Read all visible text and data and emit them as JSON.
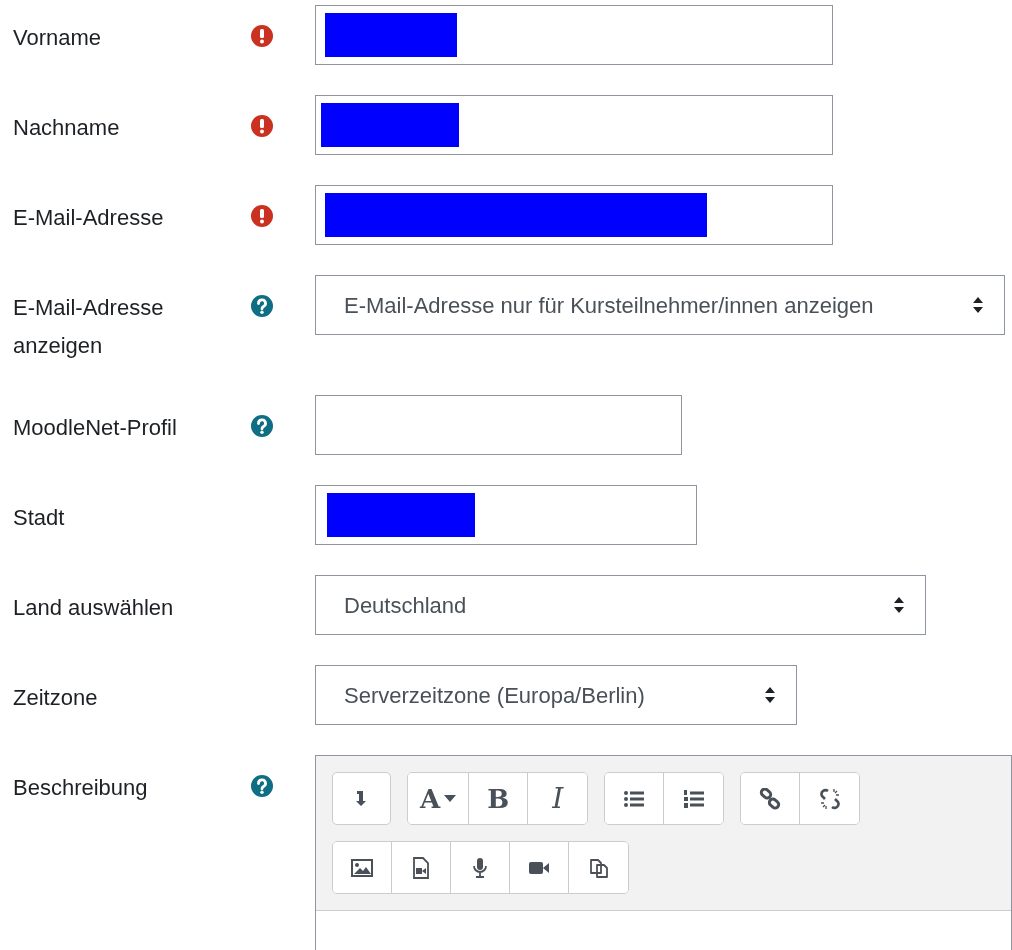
{
  "fields": [
    {
      "label": "Vorname",
      "required": true,
      "help": false,
      "kind": "text",
      "redacted": true
    },
    {
      "label": "Nachname",
      "required": true,
      "help": false,
      "kind": "text",
      "redacted": true
    },
    {
      "label": "E-Mail-Adresse",
      "required": true,
      "help": false,
      "kind": "text",
      "redacted": true
    },
    {
      "label": "E-Mail-Adresse anzeigen",
      "required": false,
      "help": true,
      "kind": "select",
      "value": "E-Mail-Adresse nur für Kursteilnehmer/innen anzeigen"
    },
    {
      "label": "MoodleNet-Profil",
      "required": false,
      "help": true,
      "kind": "text",
      "redacted": false
    },
    {
      "label": "Stadt",
      "required": false,
      "help": false,
      "kind": "text",
      "redacted": true
    },
    {
      "label": "Land auswählen",
      "required": false,
      "help": false,
      "kind": "select",
      "value": "Deutschland"
    },
    {
      "label": "Zeitzone",
      "required": false,
      "help": false,
      "kind": "select",
      "value": "Serverzeitzone (Europa/Berlin)"
    },
    {
      "label": "Beschreibung",
      "required": false,
      "help": true,
      "kind": "editor"
    }
  ],
  "editor_toolbar": [
    [
      [
        {
          "kind": "expand"
        }
      ],
      [
        {
          "kind": "font",
          "label": "A"
        },
        {
          "kind": "bold",
          "label": "B"
        },
        {
          "kind": "italic",
          "label": "I"
        }
      ],
      [
        {
          "kind": "bullets"
        },
        {
          "kind": "numbers"
        }
      ],
      [
        {
          "kind": "link"
        },
        {
          "kind": "unlink"
        }
      ]
    ],
    [
      [
        {
          "kind": "image"
        },
        {
          "kind": "media"
        },
        {
          "kind": "audio"
        },
        {
          "kind": "video"
        },
        {
          "kind": "copy"
        }
      ]
    ]
  ]
}
